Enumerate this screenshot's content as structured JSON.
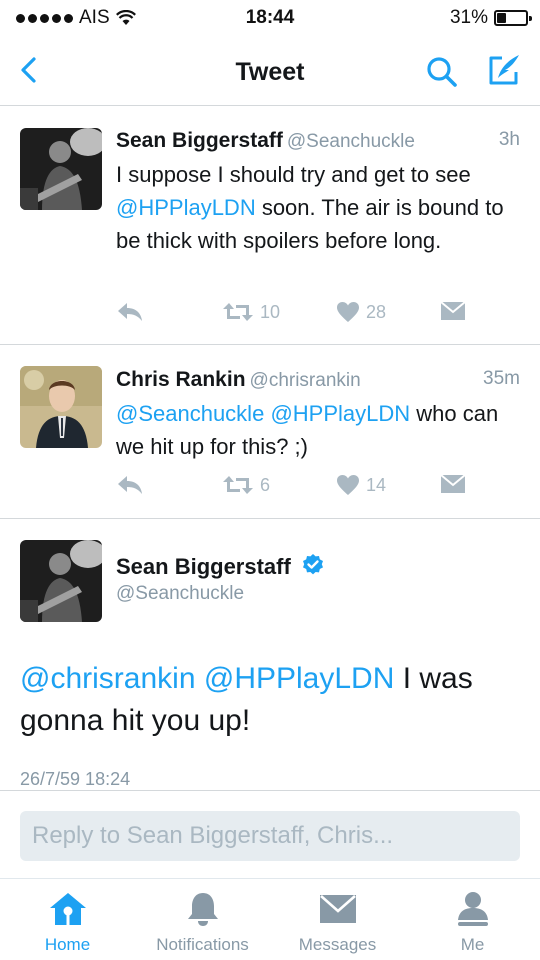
{
  "status_bar": {
    "carrier": "AIS",
    "time": "18:44",
    "battery": "31%",
    "battery_level": 0.31
  },
  "nav": {
    "title": "Tweet",
    "accent": "#1da1f2"
  },
  "tweets": [
    {
      "name": "Sean Biggerstaff",
      "handle": "@Seanchuckle",
      "time": "3h",
      "text": [
        {
          "t": "I suppose I should try and get to see ",
          "m": false
        },
        {
          "t": "@HPPlayLDN",
          "m": true
        },
        {
          "t": " soon. The air is bound to be thick with spoilers before long.",
          "m": false
        }
      ],
      "retweets": "10",
      "likes": "28"
    },
    {
      "name": "Chris Rankin",
      "handle": "@chrisrankin",
      "time": "35m",
      "text": [
        {
          "t": "@Seanchuckle",
          "m": true
        },
        {
          "t": " ",
          "m": false
        },
        {
          "t": "@HPPlayLDN",
          "m": true
        },
        {
          "t": " who can we hit up for this? ;)",
          "m": false
        }
      ],
      "retweets": "6",
      "likes": "14"
    }
  ],
  "detail": {
    "name": "Sean Biggerstaff",
    "handle": "@Seanchuckle",
    "verified": true,
    "text": [
      {
        "t": "@chrisrankin",
        "m": true
      },
      {
        "t": " ",
        "m": false
      },
      {
        "t": "@HPPlayLDN",
        "m": true
      },
      {
        "t": " I was gonna hit you up!",
        "m": false
      }
    ],
    "timestamp": "26/7/59 18:24"
  },
  "reply": {
    "placeholder": "Reply to Sean Biggerstaff, Chris..."
  },
  "tab_bar": {
    "items": [
      {
        "label": "Home",
        "icon": "home-icon",
        "active": true
      },
      {
        "label": "Notifications",
        "icon": "bell-icon",
        "active": false
      },
      {
        "label": "Messages",
        "icon": "envelope-icon",
        "active": false
      },
      {
        "label": "Me",
        "icon": "person-icon",
        "active": false
      }
    ]
  }
}
